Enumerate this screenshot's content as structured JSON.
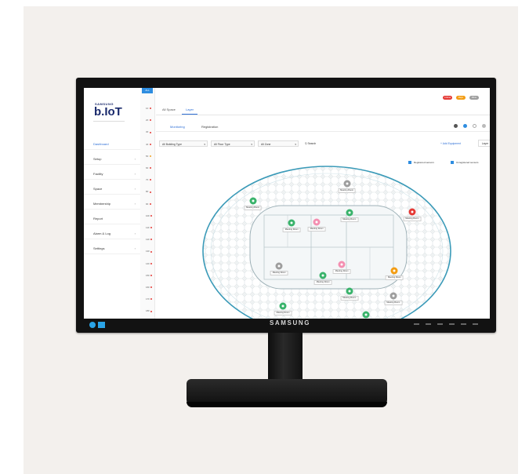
{
  "monitor": {
    "brand": "SAMSUNG"
  },
  "app": {
    "brand_small": "SAMSUNG",
    "brand": "b.IoT",
    "rail_header": "ALL"
  },
  "sidebar": {
    "items": [
      {
        "label": "Dashboard",
        "active": true
      },
      {
        "label": "Setup",
        "chevron": true
      },
      {
        "label": "Facility",
        "chevron": true
      },
      {
        "label": "Space",
        "chevron": true
      },
      {
        "label": "Membership",
        "chevron": true
      },
      {
        "label": "Report",
        "chevron": false
      },
      {
        "label": "Alarm & Log",
        "chevron": true
      },
      {
        "label": "Settings",
        "chevron": true
      }
    ]
  },
  "rail_items": [
    {
      "label": "1F",
      "dot": "#e53935"
    },
    {
      "label": "2F",
      "dot": "#e53935"
    },
    {
      "label": "3F",
      "dot": "#e53935"
    },
    {
      "label": "4F",
      "dot": "#e53935"
    },
    {
      "label": "5F",
      "dot": "#f0a020"
    },
    {
      "label": "6F",
      "dot": "#e53935"
    },
    {
      "label": "7F",
      "dot": "#e53935"
    },
    {
      "label": "8F",
      "dot": "#e53935"
    },
    {
      "label": "9F",
      "dot": "#e53935"
    },
    {
      "label": "10F",
      "dot": "#e53935"
    },
    {
      "label": "11F",
      "dot": "#e53935"
    },
    {
      "label": "12F",
      "dot": "#e53935"
    },
    {
      "label": "13F",
      "dot": "#e53935"
    },
    {
      "label": "14F",
      "dot": "#e53935"
    },
    {
      "label": "15F",
      "dot": "#e53935"
    },
    {
      "label": "16F",
      "dot": "#e53935"
    },
    {
      "label": "17F",
      "dot": "#e53935"
    },
    {
      "label": "18F",
      "dot": "#e53935"
    }
  ],
  "header": {
    "badges": [
      {
        "label": "Critical",
        "color": "#e53935"
      },
      {
        "label": "Major",
        "color": "#f39c12"
      },
      {
        "label": "Minor",
        "color": "#9e9e9e"
      }
    ]
  },
  "tabs": [
    {
      "label": "All Space"
    },
    {
      "label": "Layer",
      "active": true
    }
  ],
  "subtabs": [
    {
      "label": "Monitoring",
      "active": true
    },
    {
      "label": "Registration"
    }
  ],
  "filters": {
    "building": "All Building Type",
    "floor": "All Floor Type",
    "zone": "All Zone",
    "search_label": "Search",
    "right_link": "+ Add Equipment",
    "right_button": "Layer"
  },
  "legend": [
    {
      "label": "Registered sensors",
      "color": "#2e8de0"
    },
    {
      "label": "Unregistered sensors",
      "color": "#2e8de0"
    }
  ],
  "markers": [
    {
      "name": "Meeting Room",
      "status": "ok",
      "color": "#39b36b",
      "x": 0.205,
      "y": 0.235
    },
    {
      "name": "Meeting Room",
      "status": "off",
      "color": "#9e9e9e",
      "x": 0.58,
      "y": 0.12
    },
    {
      "name": "Meeting Room",
      "status": "ok",
      "color": "#39b36b",
      "x": 0.59,
      "y": 0.31
    },
    {
      "name": "Meeting Room",
      "status": "error",
      "color": "#e53935",
      "x": 0.84,
      "y": 0.305
    },
    {
      "name": "Meeting Room",
      "status": "ok",
      "color": "#39b36b",
      "x": 0.36,
      "y": 0.38
    },
    {
      "name": "Meeting Room",
      "status": "off",
      "color": "#f48fb1",
      "x": 0.46,
      "y": 0.37
    },
    {
      "name": "Meeting Room",
      "status": "off",
      "color": "#f48fb1",
      "x": 0.56,
      "y": 0.65
    },
    {
      "name": "Meeting Room",
      "status": "off",
      "color": "#9e9e9e",
      "x": 0.31,
      "y": 0.66
    },
    {
      "name": "Meeting Room",
      "status": "ok",
      "color": "#39b36b",
      "x": 0.485,
      "y": 0.72
    },
    {
      "name": "Meeting Room",
      "status": "warning",
      "color": "#f39c12",
      "x": 0.77,
      "y": 0.69
    },
    {
      "name": "Meeting Room",
      "status": "ok",
      "color": "#39b36b",
      "x": 0.59,
      "y": 0.82
    },
    {
      "name": "Meeting Room",
      "status": "off",
      "color": "#9e9e9e",
      "x": 0.765,
      "y": 0.85
    },
    {
      "name": "Meeting Room",
      "status": "ok",
      "color": "#39b36b",
      "x": 0.325,
      "y": 0.92
    },
    {
      "name": "Meeting Room",
      "status": "ok",
      "color": "#39b36b",
      "x": 0.655,
      "y": 0.975
    }
  ]
}
